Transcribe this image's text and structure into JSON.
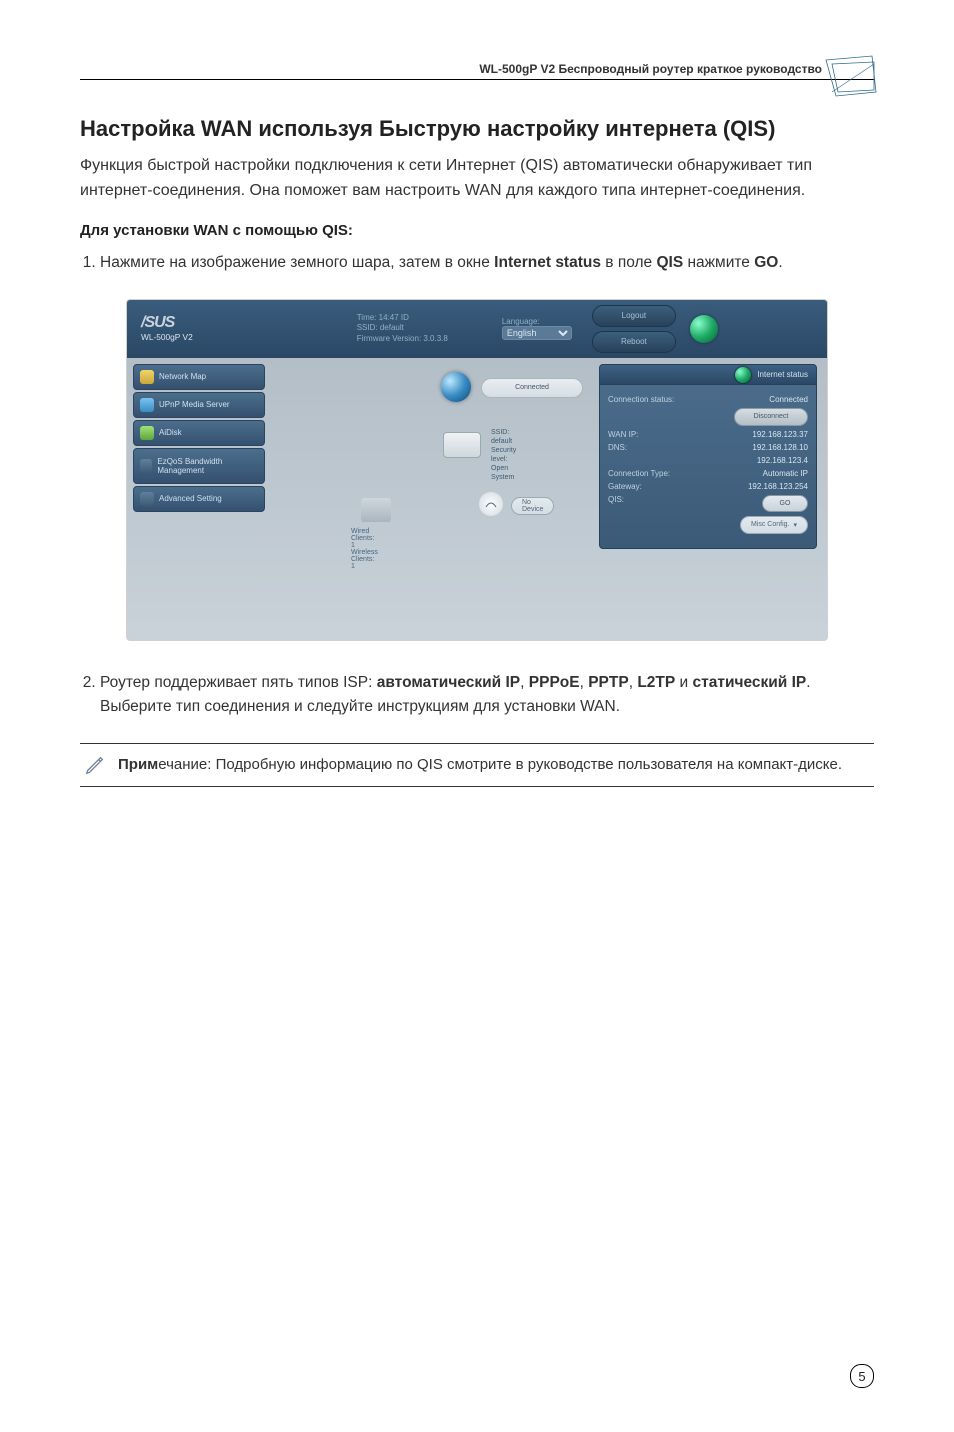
{
  "header": {
    "title": "WL-500gP V2 Беспроводный роутер краткое руководство"
  },
  "section": {
    "heading": "Настройка WAN используя Быструю настройку интернета (QIS)",
    "intro": "Функция быстрой настройки подключения к сети Интернет (QIS) автоматически обнаруживает тип интернет-соединения. Она поможет вам настроить  WAN для каждого типа интернет-соединения.",
    "sub": "Для установки WAN с помощью QIS:",
    "step1_pre": "Нажмите на изображение земного шара, затем в окне ",
    "step1_b1": "Internet status",
    "step1_mid": " в поле ",
    "step1_b2": "QIS",
    "step1_mid2": " нажмите ",
    "step1_b3": "GO",
    "step1_end": ".",
    "step2_pre": "Роутер поддерживает пять типов ISP: ",
    "step2_b1": "автоматический IP",
    "sep": ", ",
    "step2_b2": "PPPoE",
    "step2_b3": "PPTP",
    "step2_b4": "L2TP",
    "and": "  и ",
    "step2_b5": "статический IP",
    "step2_end": ". Выберите тип соединения и следуйте инструкциям для установки WAN."
  },
  "note": {
    "b": "Прим",
    "rest": "ечание: Подробную информацию по  QIS смотрите в руководстве пользователя на компакт-диске."
  },
  "ui": {
    "logo": "/SUS",
    "logo_sub": "WL-500gP V2",
    "info_time": "Time: 14:47 ID",
    "info_ssid": "SSID: default",
    "info_fw": "Firmware Version: 3.0.3.8",
    "lang_label": "Language:",
    "lang_sel": "English",
    "btn_logout": "Logout",
    "btn_reboot": "Reboot",
    "side": {
      "map": "Network Map",
      "upnp": "UPnP Media Server",
      "aidisk": "AiDisk",
      "ezqos": "EzQoS Bandwidth Management",
      "adv": "Advanced Setting"
    },
    "diag": {
      "connected": "Connected",
      "ssid": "SSID: default",
      "sec": "Security level: Open System",
      "ns": "No Device",
      "wired": "Wired Clients: 1",
      "wless": "Wireless Clients: 1"
    },
    "status": {
      "title": "Internet status",
      "rows": {
        "conn_k": "Connection status:",
        "conn_v": "Connected",
        "disc": "Disconnect",
        "wan_k": "WAN IP:",
        "wan_v": "192.168.123.37",
        "dns_k": "DNS:",
        "dns_v1": "192.168.128.10",
        "dns_v2": "192.168.123.4",
        "ct_k": "Connection Type:",
        "ct_v": "Automatic IP",
        "gw_k": "Gateway:",
        "gw_v": "192.168.123.254",
        "qis_k": "QIS:",
        "go": "GO",
        "misc": "Misc Config."
      }
    }
  },
  "page_no": "5"
}
